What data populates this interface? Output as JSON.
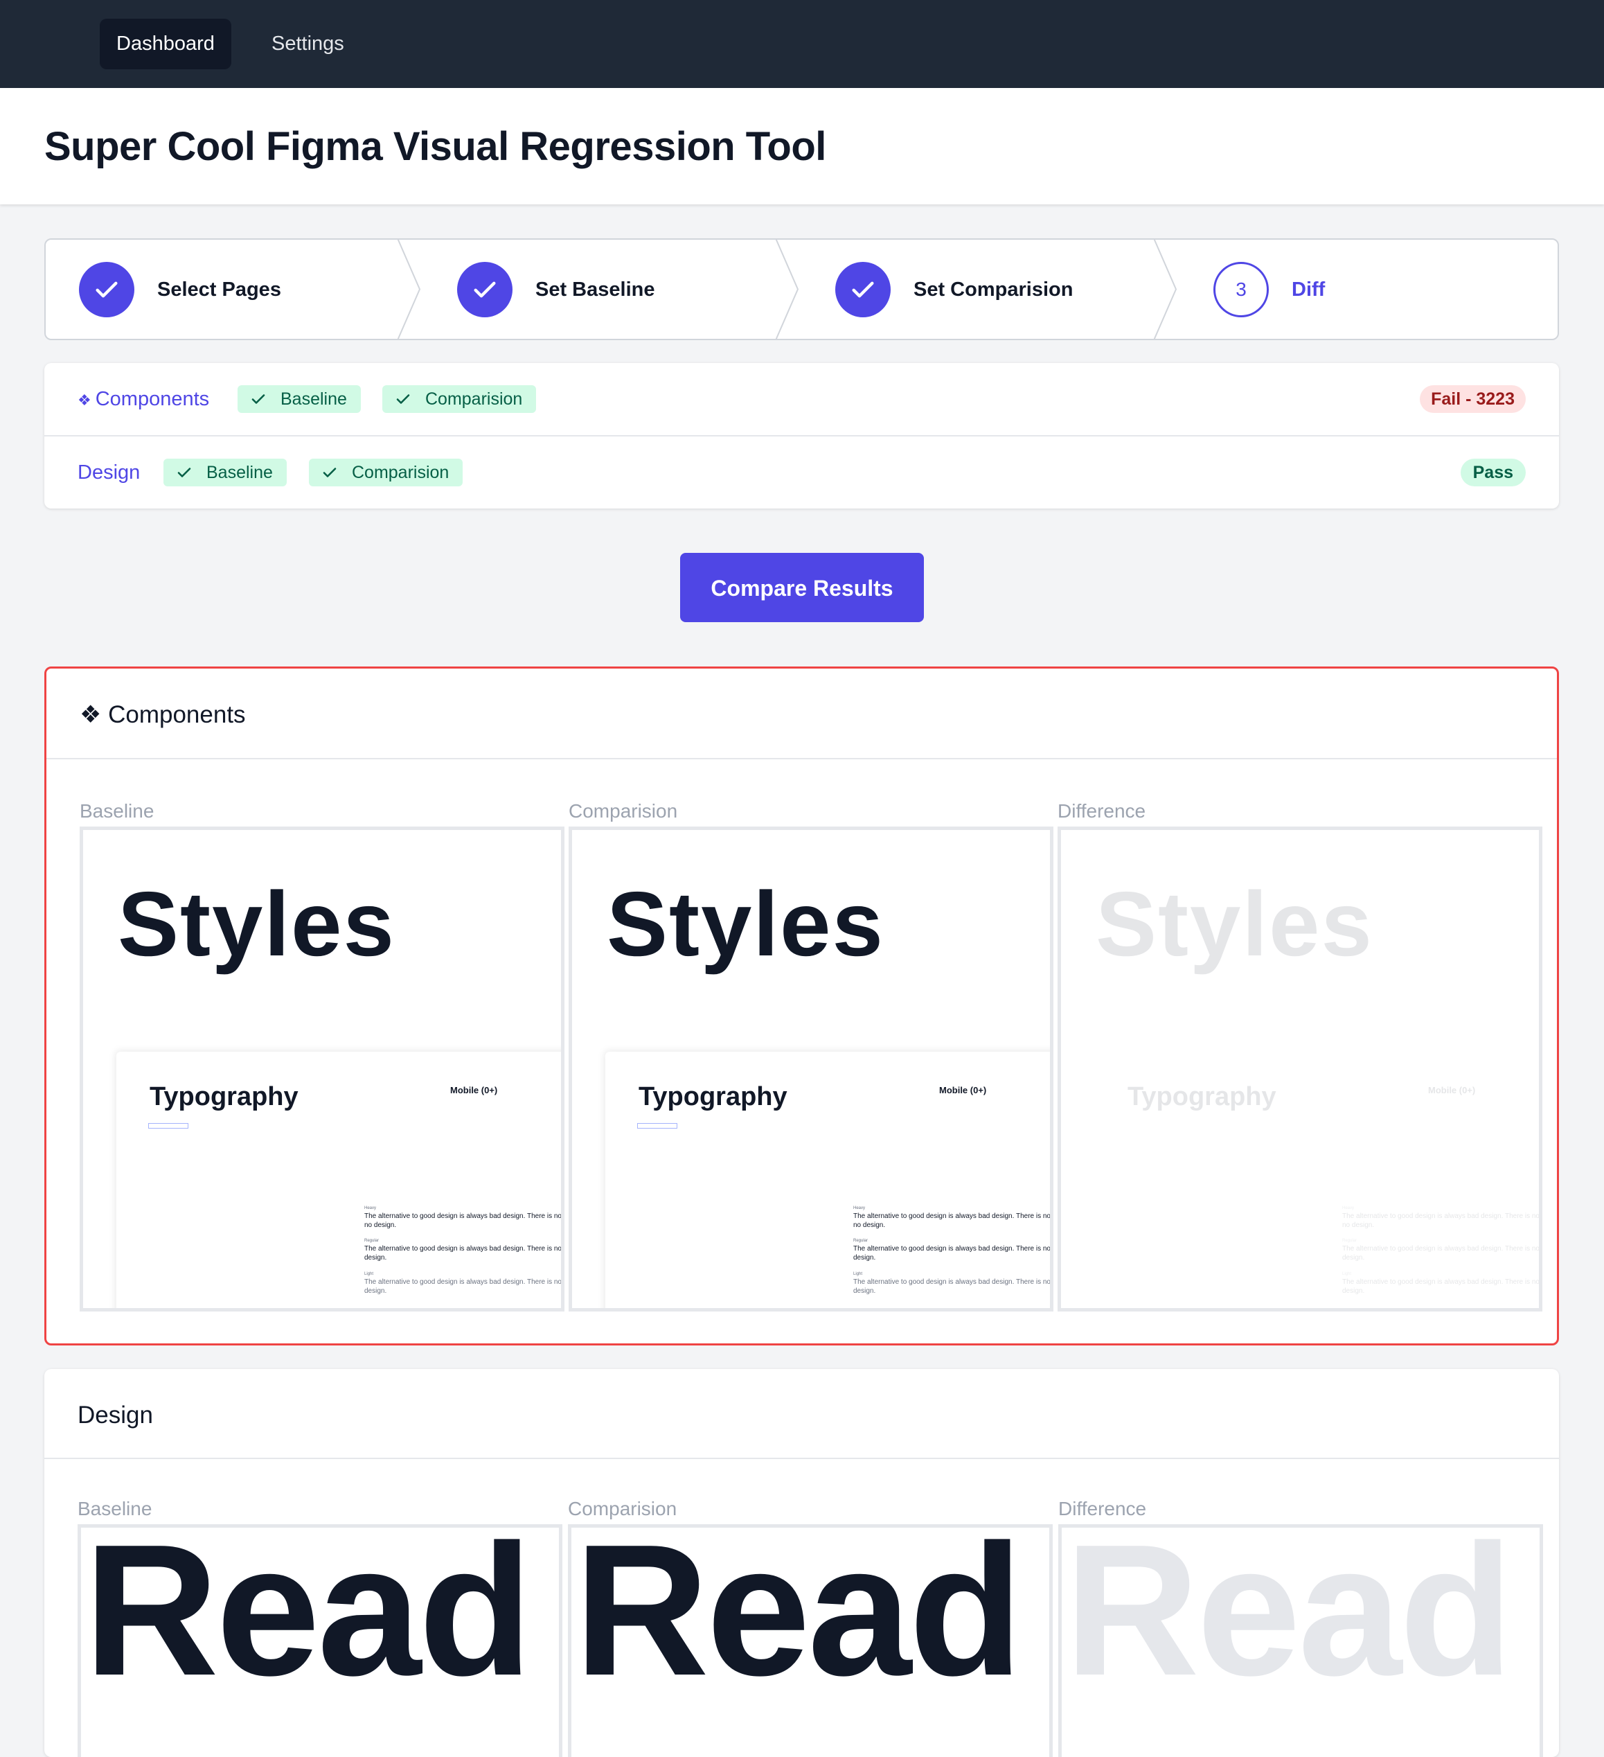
{
  "nav": {
    "tabs": [
      "Dashboard",
      "Settings"
    ]
  },
  "header": {
    "title": "Super Cool Figma Visual Regression Tool"
  },
  "stepper": {
    "steps": [
      {
        "label": "Select Pages",
        "state": "complete",
        "icon": "check-icon"
      },
      {
        "label": "Set Baseline",
        "state": "complete",
        "icon": "check-icon"
      },
      {
        "label": "Set Comparision",
        "state": "complete",
        "icon": "check-icon"
      },
      {
        "label": "Diff",
        "state": "current",
        "number": "3"
      }
    ]
  },
  "pages": [
    {
      "name": "Components",
      "icon": "component-diamond-icon",
      "badges": [
        "Baseline",
        "Comparision"
      ],
      "status": "Fail - 3223",
      "status_type": "fail"
    },
    {
      "name": "Design",
      "badges": [
        "Baseline",
        "Comparision"
      ],
      "status": "Pass",
      "status_type": "pass"
    }
  ],
  "actions": {
    "compare_label": "Compare Results"
  },
  "results": [
    {
      "title": "Components",
      "icon": "component-diamond-icon",
      "status_type": "fail",
      "columns": [
        "Baseline",
        "Comparision",
        "Difference"
      ],
      "preview": {
        "heading": "Styles",
        "subheading": "Typography",
        "device_label": "Mobile (0+)",
        "sample_weights": [
          "Heavy",
          "Regular",
          "Light"
        ],
        "sample_lines": [
          "The alternative to good design is always bad design. There is no su",
          "no design.",
          "The alternative to good design is always bad design. There is no such",
          "design.",
          "The alternative to good design is always bad design. There is no such th",
          "design."
        ]
      }
    },
    {
      "title": "Design",
      "status_type": "pass",
      "columns": [
        "Baseline",
        "Comparision",
        "Difference"
      ],
      "preview": {
        "heading": "Read"
      }
    }
  ],
  "colors": {
    "nav_bg": "#1f2937",
    "accent": "#4f46e5",
    "fail_border": "#ef4444",
    "success_badge_bg": "#d1fae5",
    "fail_badge_bg": "#fee2e2"
  }
}
